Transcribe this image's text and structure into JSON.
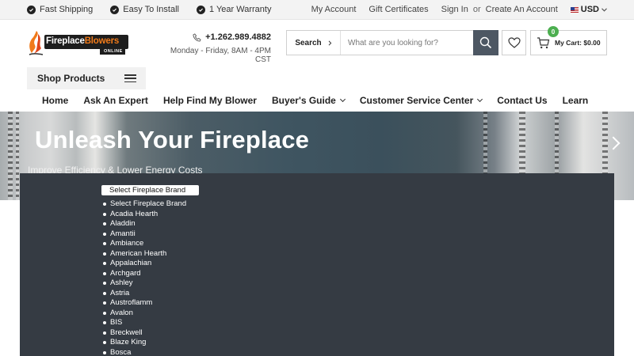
{
  "topbar": {
    "perks": [
      "Fast Shipping",
      "Easy To Install",
      "1 Year Warranty"
    ],
    "links": {
      "my_account": "My Account",
      "gift_certificates": "Gift Certificates",
      "sign_in": "Sign In",
      "or": "or",
      "create_account": "Create An Account",
      "currency": "USD"
    }
  },
  "header": {
    "logo": {
      "word1": "Fireplace",
      "word2": "Blowers",
      "tag": "ONLINE"
    },
    "phone": "+1.262.989.4882",
    "hours": "Monday - Friday, 8AM - 4PM CST",
    "search": {
      "scope_label": "Search",
      "placeholder": "What are you looking for?"
    },
    "cart": {
      "count": "0",
      "label": "My Cart: $0.00"
    },
    "shop_products": "Shop Products"
  },
  "nav": {
    "items": [
      {
        "label": "Home"
      },
      {
        "label": "Ask An Expert"
      },
      {
        "label": "Help Find My Blower"
      },
      {
        "label": "Buyer's Guide"
      },
      {
        "label": "Customer Service Center"
      },
      {
        "label": "Contact Us"
      },
      {
        "label": "Learn"
      }
    ]
  },
  "hero": {
    "title": "Unleash Your Fireplace",
    "subtitle": "Improve Efficiency & Lower Energy Costs"
  },
  "brand_select": {
    "selected": "Select Fireplace Brand",
    "options": [
      "Select Fireplace Brand",
      "Acadia Hearth",
      "Aladdin",
      "Amantii",
      "Ambiance",
      "American Hearth",
      "Appalachian",
      "Archgard",
      "Ashley",
      "Astria",
      "Austroflamm",
      "Avalon",
      "BIS",
      "Breckwell",
      "Blaze King",
      "Bosca"
    ]
  },
  "colors": {
    "accent_dark": "#4d5763",
    "cart_badge": "#4caf50",
    "panel_bg": "#353b43",
    "logo_orange": "#f07a1a"
  }
}
